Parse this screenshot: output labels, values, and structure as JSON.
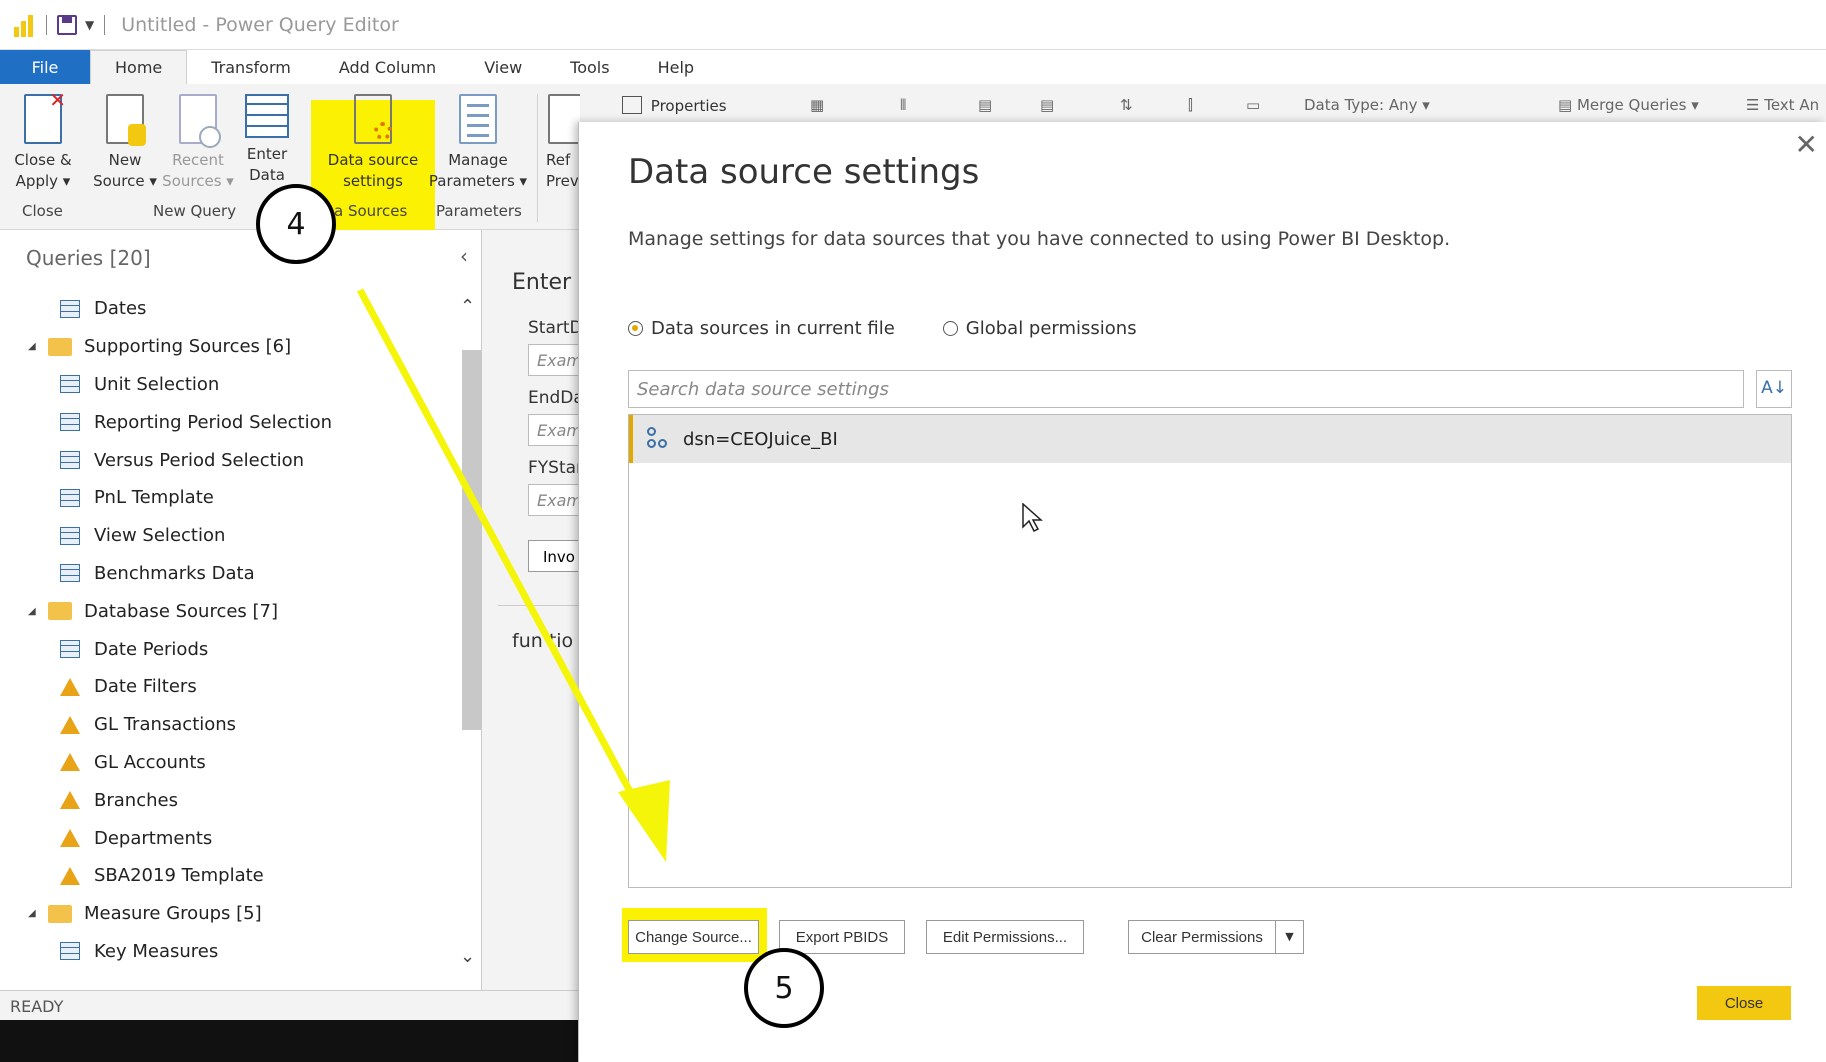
{
  "window": {
    "title": "Untitled - Power Query Editor"
  },
  "tabs": [
    {
      "label": "File"
    },
    {
      "label": "Home"
    },
    {
      "label": "Transform"
    },
    {
      "label": "Add Column"
    },
    {
      "label": "View"
    },
    {
      "label": "Tools"
    },
    {
      "label": "Help"
    }
  ],
  "ribbon": {
    "close_apply": [
      "Close &",
      "Apply ▾"
    ],
    "new_source": [
      "New",
      "Source ▾"
    ],
    "recent_sources": [
      "Recent",
      "Sources ▾"
    ],
    "enter_data": [
      "Enter",
      "Data"
    ],
    "data_source_settings": [
      "Data source",
      "settings"
    ],
    "manage_parameters": [
      "Manage",
      "Parameters ▾"
    ],
    "refresh_preview": [
      "Ref",
      "Prev"
    ],
    "properties": "Properties",
    "data_type": "Data Type: Any ▾",
    "merge_queries": "Merge Queries ▾",
    "text_analytics": "Text An",
    "groups": {
      "close": "Close",
      "new_query": "New Query",
      "data_sources": "a Sources",
      "parameters": "Parameters"
    }
  },
  "queries": {
    "header": "Queries [20]",
    "items": [
      {
        "type": "table",
        "label": "Dates"
      },
      {
        "type": "folder",
        "label": "Supporting Sources [6]"
      },
      {
        "type": "table",
        "label": "Unit Selection"
      },
      {
        "type": "table",
        "label": "Reporting Period Selection"
      },
      {
        "type": "table",
        "label": "Versus Period Selection"
      },
      {
        "type": "table",
        "label": "PnL Template"
      },
      {
        "type": "table",
        "label": "View Selection"
      },
      {
        "type": "table",
        "label": "Benchmarks Data"
      },
      {
        "type": "folder",
        "label": "Database Sources [7]"
      },
      {
        "type": "table",
        "label": "Date Periods"
      },
      {
        "type": "warning",
        "label": "Date Filters"
      },
      {
        "type": "warning",
        "label": "GL Transactions"
      },
      {
        "type": "warning",
        "label": "GL Accounts"
      },
      {
        "type": "warning",
        "label": "Branches"
      },
      {
        "type": "warning",
        "label": "Departments"
      },
      {
        "type": "warning",
        "label": "SBA2019 Template"
      },
      {
        "type": "folder",
        "label": "Measure Groups [5]"
      },
      {
        "type": "table",
        "label": "Key Measures"
      }
    ]
  },
  "editor": {
    "title": "Enter",
    "params": [
      {
        "label": "StartD",
        "placeholder": "Exam"
      },
      {
        "label": "EndDa",
        "placeholder": "Exam"
      },
      {
        "label": "FYStar",
        "placeholder": "Exam"
      }
    ],
    "invoke": "Invo",
    "function_text": "fun tio"
  },
  "status": "READY",
  "dialog": {
    "title": "Data source settings",
    "description": "Manage settings for data sources that you have connected to using Power BI Desktop.",
    "radio_current": "Data sources in current file",
    "radio_global": "Global permissions",
    "search_placeholder": "Search data source settings",
    "sources": [
      {
        "label": "dsn=CEOJuice_BI"
      }
    ],
    "buttons": {
      "change_source": "Change Source...",
      "export_pbids": "Export PBIDS",
      "edit_permissions": "Edit Permissions...",
      "clear_permissions": "Clear Permissions",
      "close": "Close"
    }
  },
  "callouts": {
    "step4": "4",
    "step5": "5"
  },
  "colors": {
    "highlight": "#fbf203",
    "accent": "#f2c811",
    "file_tab": "#1f6fc5",
    "arrow": "#f5f50a"
  }
}
